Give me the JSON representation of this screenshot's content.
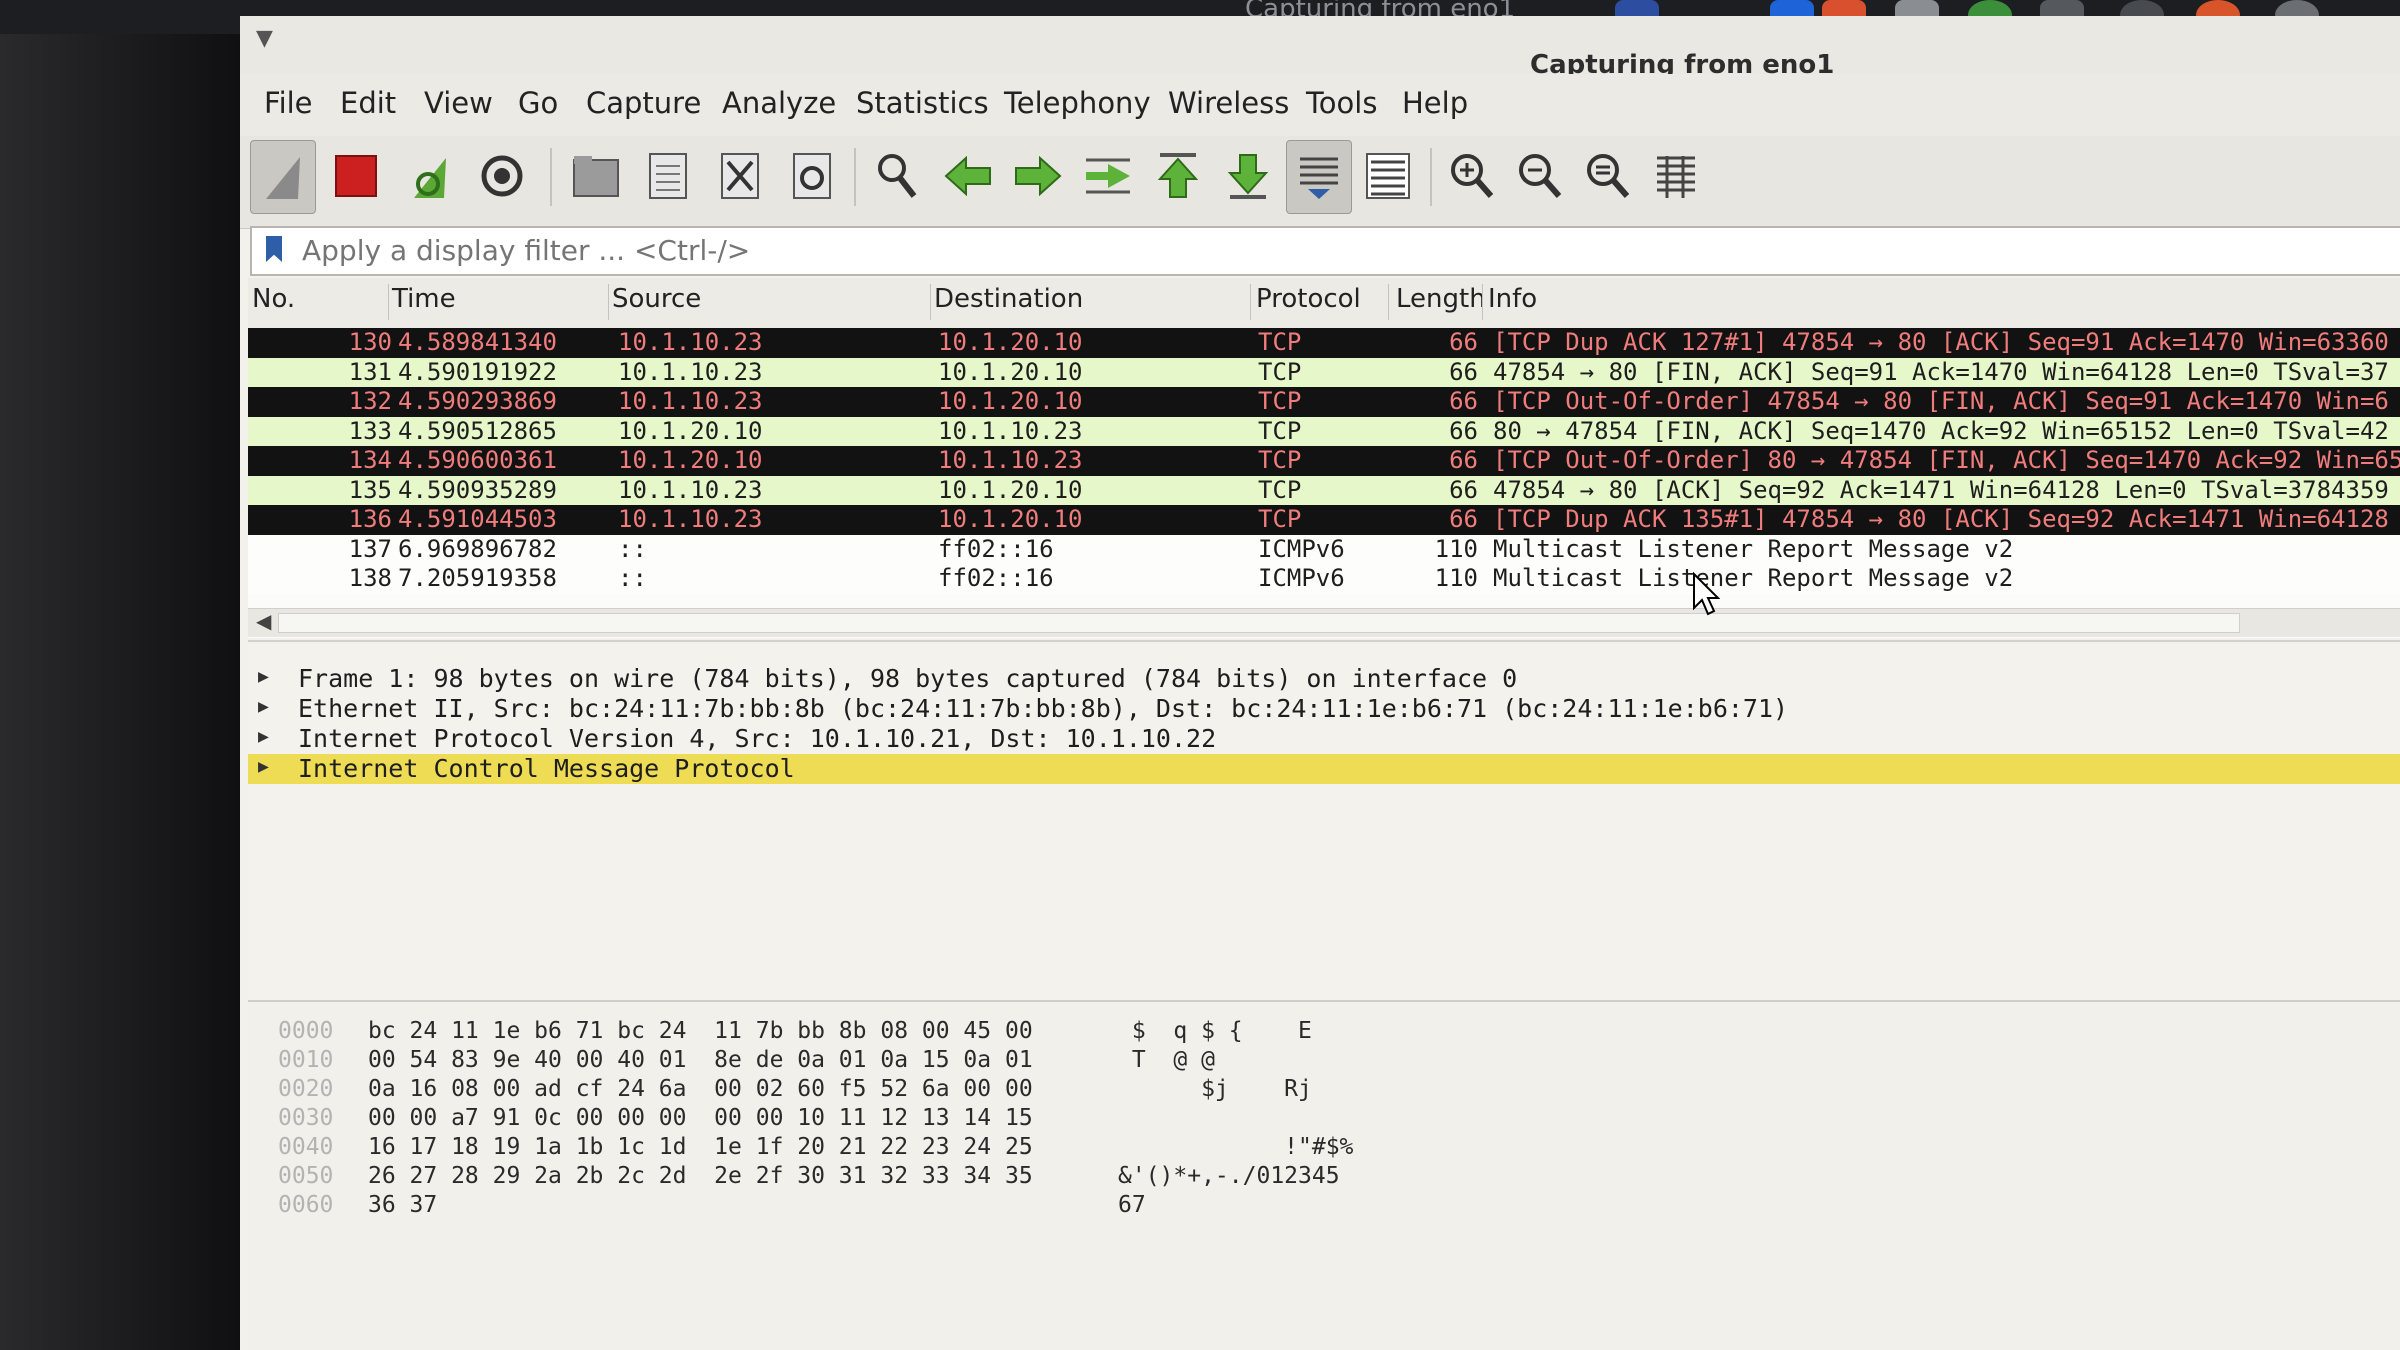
{
  "topbar": {
    "title": "Capturing from eno1"
  },
  "window": {
    "title": "Capturing from eno1"
  },
  "menu": [
    "File",
    "Edit",
    "View",
    "Go",
    "Capture",
    "Analyze",
    "Statistics",
    "Telephony",
    "Wireless",
    "Tools",
    "Help"
  ],
  "toolbar": {
    "icons": [
      "shark-fin-start-icon",
      "stop-capture-icon",
      "restart-capture-icon",
      "capture-options-icon",
      "open-file-icon",
      "save-file-icon",
      "close-file-icon",
      "reload-file-icon",
      "find-packet-icon",
      "go-back-icon",
      "go-forward-icon",
      "go-to-packet-icon",
      "first-packet-icon",
      "last-packet-icon",
      "autoscroll-icon",
      "colorize-icon",
      "zoom-in-icon",
      "zoom-out-icon",
      "zoom-normal-icon",
      "resize-columns-icon"
    ]
  },
  "filter": {
    "placeholder": "Apply a display filter ... <Ctrl-/>"
  },
  "columns": {
    "no": "No.",
    "time": "Time",
    "source": "Source",
    "destination": "Destination",
    "protocol": "Protocol",
    "length": "Length",
    "info": "Info"
  },
  "rows": [
    {
      "no": "130",
      "time": "4.589841340",
      "src": "10.1.10.23",
      "dst": "10.1.20.10",
      "proto": "TCP",
      "len": "66",
      "info": "[TCP Dup ACK 127#1] 47854 → 80 [ACK] Seq=91 Ack=1470 Win=63360",
      "style": "dark"
    },
    {
      "no": "131",
      "time": "4.590191922",
      "src": "10.1.10.23",
      "dst": "10.1.20.10",
      "proto": "TCP",
      "len": "66",
      "info": "47854 → 80 [FIN, ACK] Seq=91 Ack=1470 Win=64128 Len=0 TSval=37",
      "style": "green"
    },
    {
      "no": "132",
      "time": "4.590293869",
      "src": "10.1.10.23",
      "dst": "10.1.20.10",
      "proto": "TCP",
      "len": "66",
      "info": "[TCP Out-Of-Order] 47854 → 80 [FIN, ACK] Seq=91 Ack=1470 Win=6",
      "style": "dark"
    },
    {
      "no": "133",
      "time": "4.590512865",
      "src": "10.1.20.10",
      "dst": "10.1.10.23",
      "proto": "TCP",
      "len": "66",
      "info": "80 → 47854 [FIN, ACK] Seq=1470 Ack=92 Win=65152 Len=0 TSval=42",
      "style": "green"
    },
    {
      "no": "134",
      "time": "4.590600361",
      "src": "10.1.20.10",
      "dst": "10.1.10.23",
      "proto": "TCP",
      "len": "66",
      "info": "[TCP Out-Of-Order] 80 → 47854 [FIN, ACK] Seq=1470 Ack=92 Win=65",
      "style": "dark"
    },
    {
      "no": "135",
      "time": "4.590935289",
      "src": "10.1.10.23",
      "dst": "10.1.20.10",
      "proto": "TCP",
      "len": "66",
      "info": "47854 → 80 [ACK] Seq=92 Ack=1471 Win=64128 Len=0 TSval=3784359",
      "style": "green"
    },
    {
      "no": "136",
      "time": "4.591044503",
      "src": "10.1.10.23",
      "dst": "10.1.20.10",
      "proto": "TCP",
      "len": "66",
      "info": "[TCP Dup ACK 135#1] 47854 → 80 [ACK] Seq=92 Ack=1471 Win=64128",
      "style": "dark"
    },
    {
      "no": "137",
      "time": "6.969896782",
      "src": "::",
      "dst": "ff02::16",
      "proto": "ICMPv6",
      "len": "110",
      "info": "Multicast Listener Report Message v2",
      "style": "plain"
    },
    {
      "no": "138",
      "time": "7.205919358",
      "src": "::",
      "dst": "ff02::16",
      "proto": "ICMPv6",
      "len": "110",
      "info": "Multicast Listener Report Message v2",
      "style": "plain"
    }
  ],
  "details": [
    {
      "text": "Frame 1: 98 bytes on wire (784 bits), 98 bytes captured (784 bits) on interface 0",
      "selected": false
    },
    {
      "text": "Ethernet II, Src: bc:24:11:7b:bb:8b (bc:24:11:7b:bb:8b), Dst: bc:24:11:1e:b6:71 (bc:24:11:1e:b6:71)",
      "selected": false
    },
    {
      "text": "Internet Protocol Version 4, Src: 10.1.10.21, Dst: 10.1.10.22",
      "selected": false
    },
    {
      "text": "Internet Control Message Protocol",
      "selected": true
    }
  ],
  "bytes": [
    {
      "offset": "0000",
      "hex": "bc 24 11 1e b6 71 bc 24  11 7b bb 8b 08 00 45 00",
      "ascii": " $  q $ {    E"
    },
    {
      "offset": "0010",
      "hex": "00 54 83 9e 40 00 40 01  8e de 0a 01 0a 15 0a 01",
      "ascii": " T  @ @"
    },
    {
      "offset": "0020",
      "hex": "0a 16 08 00 ad cf 24 6a  00 02 60 f5 52 6a 00 00",
      "ascii": "      $j    Rj"
    },
    {
      "offset": "0030",
      "hex": "00 00 a7 91 0c 00 00 00  00 00 10 11 12 13 14 15",
      "ascii": ""
    },
    {
      "offset": "0040",
      "hex": "16 17 18 19 1a 1b 1c 1d  1e 1f 20 21 22 23 24 25",
      "ascii": "            !\"#$%"
    },
    {
      "offset": "0050",
      "hex": "26 27 28 29 2a 2b 2c 2d  2e 2f 30 31 32 33 34 35",
      "ascii": "&'()*+,-./012345"
    },
    {
      "offset": "0060",
      "hex": "36 37",
      "ascii": "67"
    }
  ]
}
